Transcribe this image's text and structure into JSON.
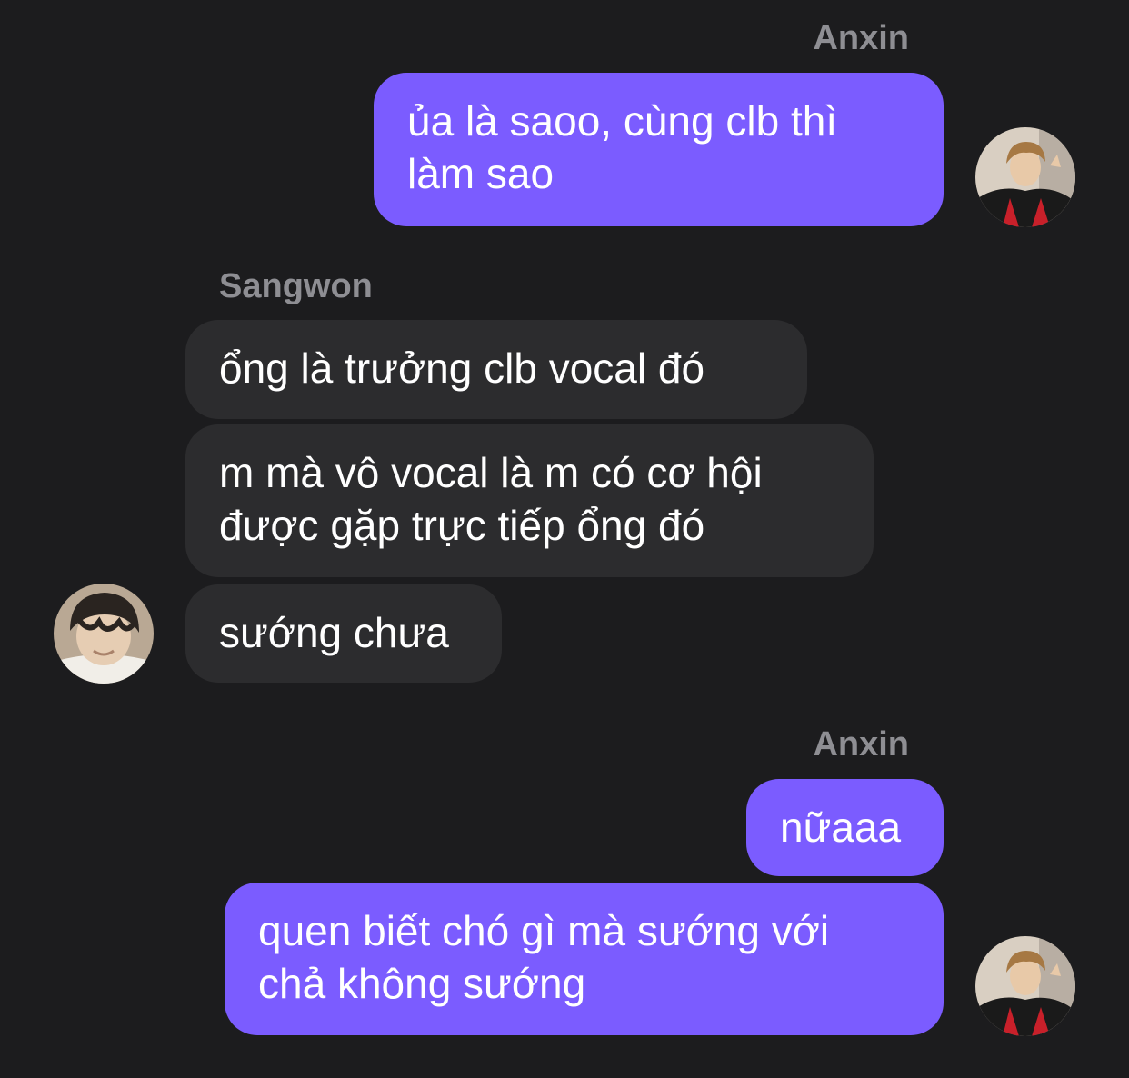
{
  "messages": [
    {
      "sender": "Anxin",
      "text": "ủa là saoo, cùng clb thì\nlàm sao"
    },
    {
      "sender": "Sangwon",
      "text": "ổng là trưởng clb vocal đó"
    },
    {
      "text": "m mà vô vocal là m có cơ hội\nđược gặp trực tiếp ổng đó"
    },
    {
      "text": "sướng chưa"
    },
    {
      "sender": "Anxin",
      "text": "nữaaa"
    },
    {
      "text": "quen biết chó gì mà sướng với\nchả không sướng"
    }
  ],
  "colors": {
    "background": "#1c1c1e",
    "outgoing_bubble": "#7b5cff",
    "incoming_bubble": "#2c2c2e",
    "sender_label": "#8e8e93",
    "message_text": "#ffffff"
  },
  "avatars": {
    "anxin": "avatar-photo-icon",
    "sangwon": "avatar-photo-icon"
  }
}
